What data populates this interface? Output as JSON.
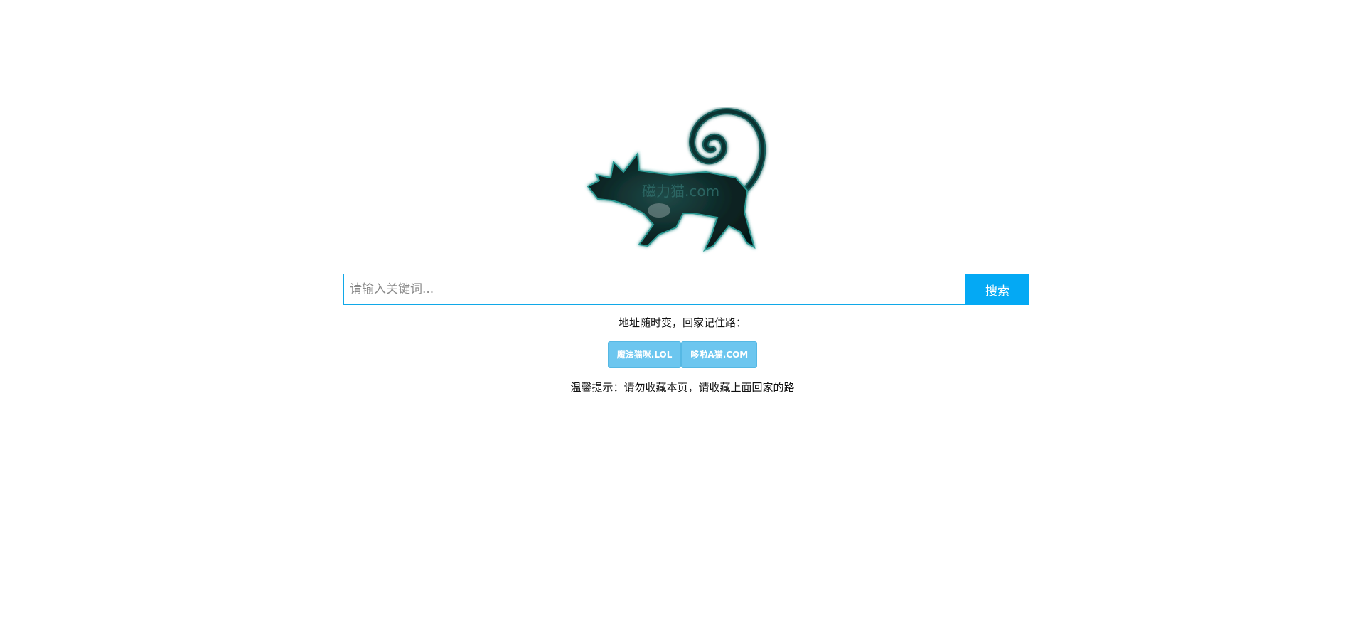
{
  "logo": {
    "icon": "cat-logo",
    "text": "磁力猫.com",
    "colors": {
      "body": "#0b2a2a",
      "glow": "#2a9a94"
    }
  },
  "search": {
    "placeholder": "请输入关键词...",
    "value": "",
    "button_label": "搜索",
    "accent": "#04a9f4"
  },
  "address_note": "地址随时变，回家记住路：",
  "mirror_links": [
    {
      "label": "魔法猫咪.LOL"
    },
    {
      "label": "哆啦A猫.COM"
    }
  ],
  "tip": "温馨提示：请勿收藏本页，请收藏上面回家的路"
}
